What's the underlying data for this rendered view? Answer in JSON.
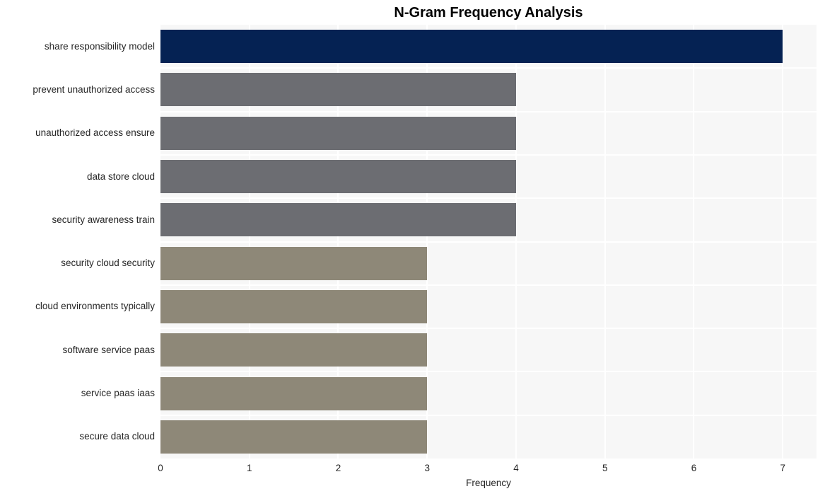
{
  "chart_data": {
    "type": "bar",
    "orientation": "horizontal",
    "title": "N-Gram Frequency Analysis",
    "xlabel": "Frequency",
    "ylabel": "",
    "xlim": [
      0,
      7.38
    ],
    "xticks": [
      "0",
      "1",
      "2",
      "3",
      "4",
      "5",
      "6",
      "7"
    ],
    "xtick_values": [
      0,
      1,
      2,
      3,
      4,
      5,
      6,
      7
    ],
    "grid": true,
    "legend": null,
    "categories": [
      "share responsibility model",
      "prevent unauthorized access",
      "unauthorized access ensure",
      "data store cloud",
      "security awareness train",
      "security cloud security",
      "cloud environments typically",
      "software service paas",
      "service paas iaas",
      "secure data cloud"
    ],
    "values": [
      7,
      4,
      4,
      4,
      4,
      3,
      3,
      3,
      3,
      3
    ],
    "bar_colors": [
      "#052253",
      "#6c6d72",
      "#6c6d72",
      "#6c6d72",
      "#6c6d72",
      "#8e8878",
      "#8e8878",
      "#8e8878",
      "#8e8878",
      "#8e8878"
    ]
  },
  "style": {
    "figure_background": "#ffffff",
    "plot_background": "#f7f7f7",
    "gridline_color": "#ffffff",
    "title_color": "#000000",
    "tick_label_color": "#262626"
  }
}
